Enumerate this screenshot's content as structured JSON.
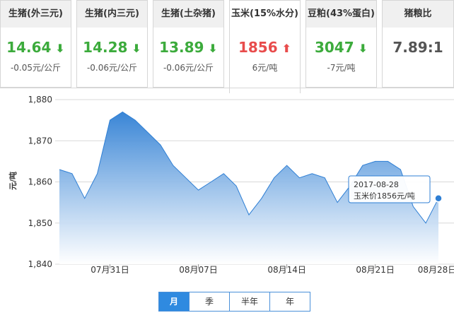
{
  "cards": [
    {
      "title": "生猪(外三元)",
      "value": "14.64",
      "direction": "down",
      "change": "-0.05元/公斤"
    },
    {
      "title": "生猪(内三元)",
      "value": "14.28",
      "direction": "down",
      "change": "-0.06元/公斤"
    },
    {
      "title": "生猪(土杂猪)",
      "value": "13.89",
      "direction": "down",
      "change": "-0.06元/公斤"
    },
    {
      "title": "玉米(15%水分)",
      "value": "1856",
      "direction": "up",
      "change": "6元/吨"
    },
    {
      "title": "豆粕(43%蛋白)",
      "value": "3047",
      "direction": "down",
      "change": "-7元/吨"
    },
    {
      "title": "猪粮比",
      "value": "7.89:1",
      "direction": "none",
      "change": ""
    }
  ],
  "icons": {
    "down": "arrow-down-icon",
    "up": "arrow-up-icon"
  },
  "colors": {
    "down": "#3cab3c",
    "up": "#e84c4c",
    "line": "#2f7fd4",
    "accent": "#2f8ae0"
  },
  "range_buttons": [
    {
      "label": "月",
      "active": true
    },
    {
      "label": "季",
      "active": false
    },
    {
      "label": "半年",
      "active": false
    },
    {
      "label": "年",
      "active": false
    }
  ],
  "chart_data": {
    "type": "area",
    "ylabel": "元/吨",
    "ylim": [
      1840,
      1880
    ],
    "yticks": [
      1840,
      1850,
      1860,
      1870,
      1880
    ],
    "ytick_labels": [
      "1,840",
      "1,850",
      "1,860",
      "1,870",
      "1,880"
    ],
    "x": [
      "07-27",
      "07-28",
      "07-29",
      "07-30",
      "07-31",
      "08-01",
      "08-02",
      "08-03",
      "08-04",
      "08-05",
      "08-06",
      "08-07",
      "08-08",
      "08-09",
      "08-10",
      "08-11",
      "08-12",
      "08-13",
      "08-14",
      "08-15",
      "08-16",
      "08-17",
      "08-18",
      "08-19",
      "08-20",
      "08-21",
      "08-22",
      "08-23",
      "08-24",
      "08-25",
      "08-26",
      "08-27",
      "08-28"
    ],
    "xtick_labels": [
      {
        "x": "07-31",
        "label": "07月31日"
      },
      {
        "x": "08-07",
        "label": "08月07日"
      },
      {
        "x": "08-14",
        "label": "08月14日"
      },
      {
        "x": "08-21",
        "label": "08月21日"
      },
      {
        "x": "08-28",
        "label": "08月28日"
      }
    ],
    "values": [
      1863,
      1862,
      1856,
      1862,
      1875,
      1877,
      1875,
      1872,
      1869,
      1864,
      1861,
      1858,
      1860,
      1862,
      1859,
      1852,
      1856,
      1861,
      1864,
      1861,
      1862,
      1861,
      1855,
      1859,
      1864,
      1865,
      1865,
      1863,
      1854,
      1850,
      1856
    ],
    "grid": true,
    "tooltip": {
      "date": "2017-08-28",
      "text": "玉米价1856元/吨"
    }
  }
}
